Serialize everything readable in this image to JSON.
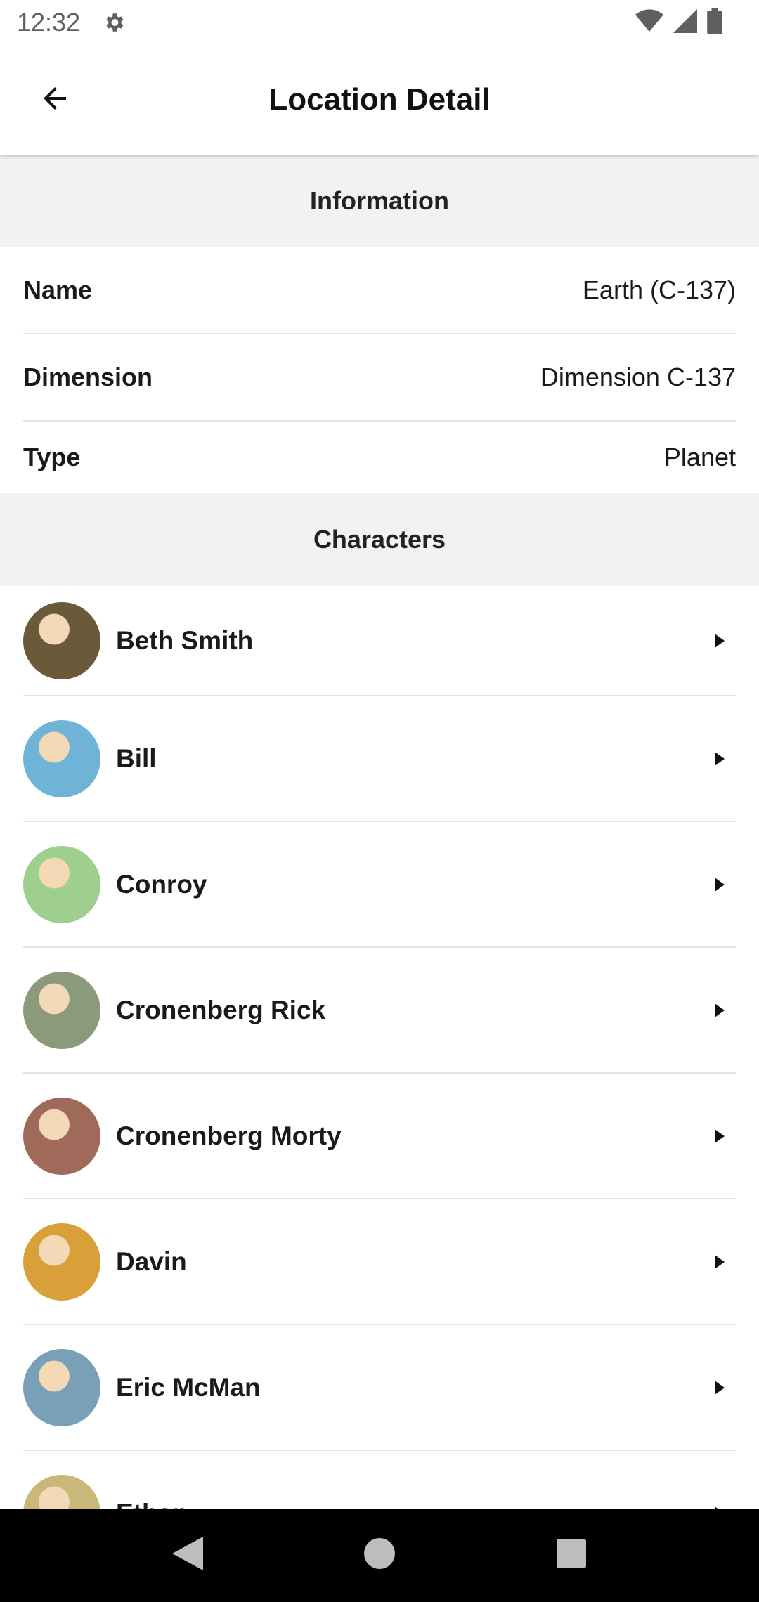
{
  "status_bar": {
    "time": "12:32",
    "icons": [
      "gear-icon",
      "wifi-icon",
      "signal-icon",
      "battery-icon"
    ]
  },
  "app_bar": {
    "title": "Location Detail",
    "back_icon": "arrow-left-icon"
  },
  "information": {
    "header": "Information",
    "rows": [
      {
        "label": "Name",
        "value": "Earth (C-137)"
      },
      {
        "label": "Dimension",
        "value": "Dimension C-137"
      },
      {
        "label": "Type",
        "value": "Planet"
      }
    ]
  },
  "characters": {
    "header": "Characters",
    "items": [
      {
        "name": "Beth Smith",
        "avatar_color": "#6b5a3a"
      },
      {
        "name": "Bill",
        "avatar_color": "#6fb3d6"
      },
      {
        "name": "Conroy",
        "avatar_color": "#9fcf8f"
      },
      {
        "name": "Cronenberg Rick",
        "avatar_color": "#8a9a7a"
      },
      {
        "name": "Cronenberg Morty",
        "avatar_color": "#a06a5a"
      },
      {
        "name": "Davin",
        "avatar_color": "#d9a03a"
      },
      {
        "name": "Eric McMan",
        "avatar_color": "#7aa0b8"
      },
      {
        "name": "Ethan",
        "avatar_color": "#c9b87a"
      }
    ]
  },
  "nav_bar": {
    "icons": [
      "back-triangle-icon",
      "home-circle-icon",
      "recents-square-icon"
    ]
  },
  "colors": {
    "section_bg": "#f2f2f4",
    "divider": "#e3e3e3",
    "text": "#1a1a1a"
  }
}
